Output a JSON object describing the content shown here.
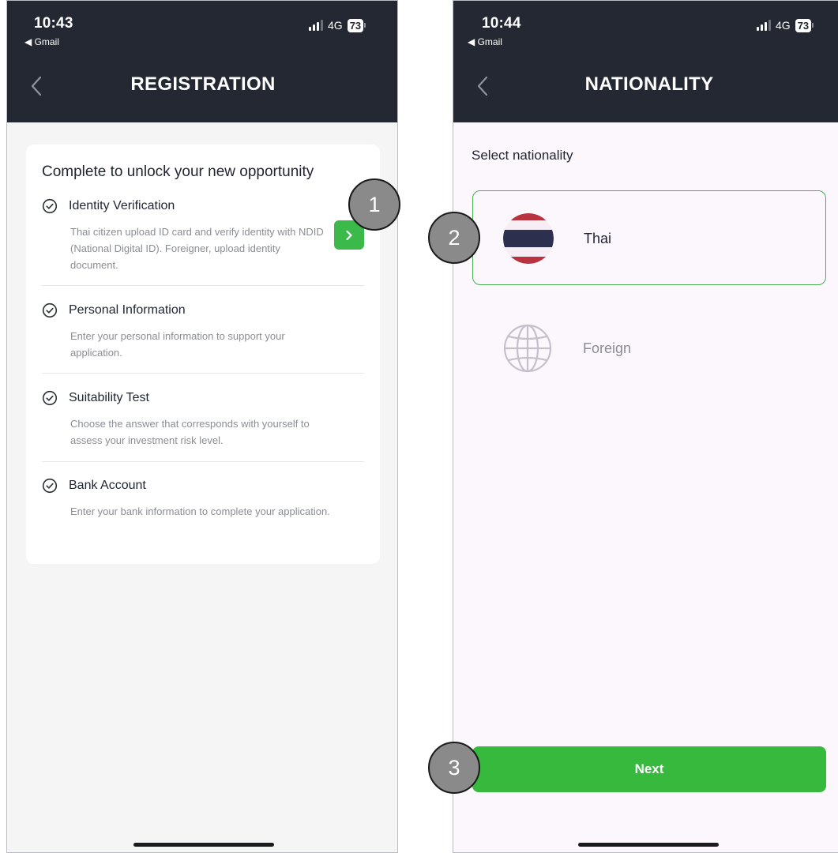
{
  "left_screen": {
    "status": {
      "time": "10:43",
      "back_app": "◀ Gmail",
      "network": "4G",
      "battery": "73"
    },
    "nav": {
      "title": "REGISTRATION"
    },
    "card": {
      "title": "Complete to unlock your new opportunity",
      "steps": [
        {
          "title": "Identity Verification",
          "description": "Thai citizen upload ID card and verify identity with NDID (National Digital ID). Foreigner, upload identity document."
        },
        {
          "title": "Personal Information",
          "description": "Enter your personal information to support your application."
        },
        {
          "title": "Suitability Test",
          "description": "Choose the answer that corresponds with yourself to assess your investment risk level."
        },
        {
          "title": "Bank Account",
          "description": "Enter your bank information to complete your application."
        }
      ]
    }
  },
  "right_screen": {
    "status": {
      "time": "10:44",
      "back_app": "◀ Gmail",
      "network": "4G",
      "battery": "73"
    },
    "nav": {
      "title": "NATIONALITY"
    },
    "section_title": "Select nationality",
    "options": [
      {
        "label": "Thai",
        "icon": "thai-flag-icon",
        "selected": true
      },
      {
        "label": "Foreign",
        "icon": "globe-icon",
        "selected": false
      }
    ],
    "next_label": "Next"
  },
  "annotations": [
    "1",
    "2",
    "3"
  ],
  "colors": {
    "header": "#232832",
    "accent_green": "#37b93e",
    "right_background": "#fcf6fd",
    "left_background": "#f5f5f6"
  }
}
